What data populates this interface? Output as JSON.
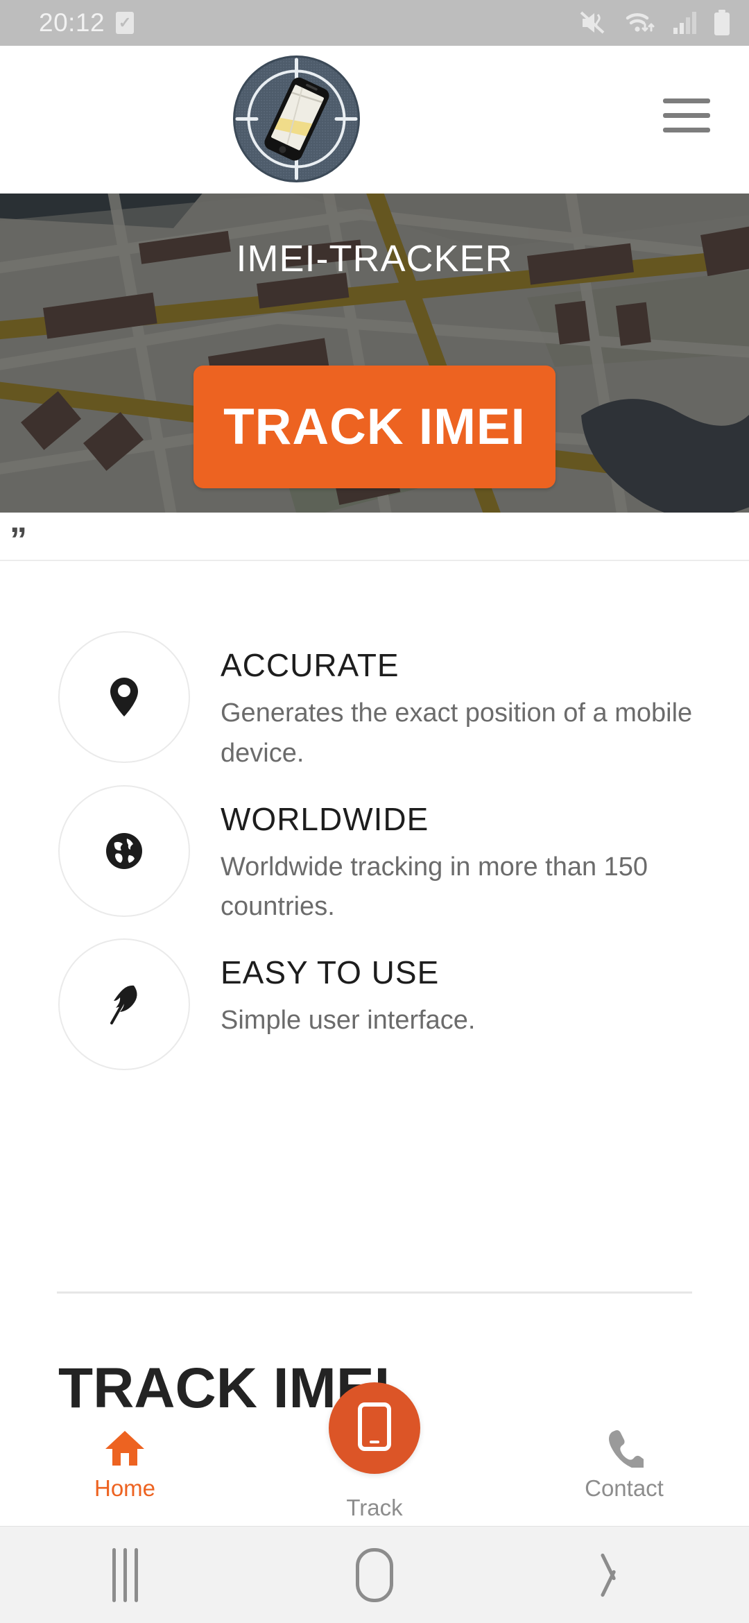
{
  "statusbar": {
    "time": "20:12",
    "check_icon": "✓",
    "icons": [
      "mute-vibrate-icon",
      "wifi-icon",
      "signal-icon",
      "battery-icon"
    ]
  },
  "header": {
    "logo_alt": "imei-tracker-logo",
    "menu_icon": "hamburger-menu-icon"
  },
  "hero": {
    "title": "IMEI-TRACKER",
    "cta_label": "TRACK IMEI",
    "accent_color": "#ED6321",
    "background": "map-background"
  },
  "quote": {
    "mark": "”"
  },
  "features": [
    {
      "icon": "map-pin-icon",
      "title": "ACCURATE",
      "description": "Generates the exact position of a mobile device."
    },
    {
      "icon": "globe-icon",
      "title": "WORLDWIDE",
      "description": "Worldwide tracking in more than 150 countries."
    },
    {
      "icon": "feather-icon",
      "title": "EASY TO USE",
      "description": "Simple user interface."
    }
  ],
  "section": {
    "heading": "TRACK IMEI"
  },
  "bottomnav": {
    "active_color": "#ED6321",
    "inactive_color": "#8d8d8d",
    "items": [
      {
        "label": "Home",
        "icon": "home-icon",
        "state": "active"
      },
      {
        "label": "Track",
        "icon": "mobile-phone-icon",
        "state": "inactive"
      },
      {
        "label": "Contact",
        "icon": "phone-handset-icon",
        "state": "inactive"
      }
    ]
  },
  "sysnav": {
    "recents": "recents-icon",
    "home": "home-button-icon",
    "back": "back-icon"
  }
}
